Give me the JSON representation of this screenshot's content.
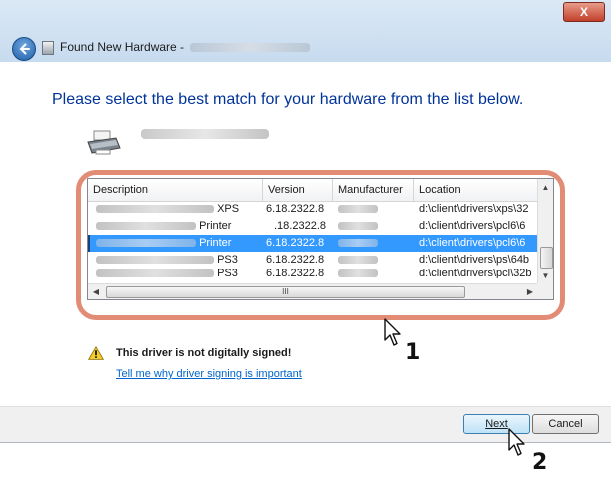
{
  "window": {
    "close_label": "X",
    "title_prefix": "Found New Hardware -"
  },
  "instruction": "Please select the best match for your hardware from the list below.",
  "driver_list": {
    "columns": [
      "Description",
      "Version",
      "Manufacturer",
      "Location"
    ],
    "rows": [
      {
        "description_suffix": "XPS",
        "version": "6.18.2322.8",
        "location": "d:\\client\\drivers\\xps\\32",
        "selected": false
      },
      {
        "description_suffix": "Printer",
        "version": ".18.2322.8",
        "location": "d:\\client\\drivers\\pcl6\\6",
        "selected": false
      },
      {
        "description_suffix": "Printer",
        "version": "6.18.2322.8",
        "location": "d:\\client\\drivers\\pcl6\\6",
        "selected": true
      },
      {
        "description_suffix": "PS3",
        "version": "6.18.2322.8",
        "location": "d:\\client\\drivers\\ps\\64b",
        "selected": false
      },
      {
        "description_suffix": "PS3",
        "version": "6.18.2322.8",
        "location": "d:\\client\\drivers\\pcl\\32b",
        "selected": false
      }
    ],
    "hscroll_grip": "III"
  },
  "warning": {
    "text": "This driver is not digitally signed!",
    "link": "Tell me why driver signing is important"
  },
  "buttons": {
    "next_label": "Next",
    "cancel_label": "Cancel"
  },
  "callouts": {
    "step1": "1",
    "step2": "2"
  },
  "colors": {
    "highlight_frame": "#e28b75",
    "selection": "#3399ff",
    "instruction_text": "#003399"
  }
}
